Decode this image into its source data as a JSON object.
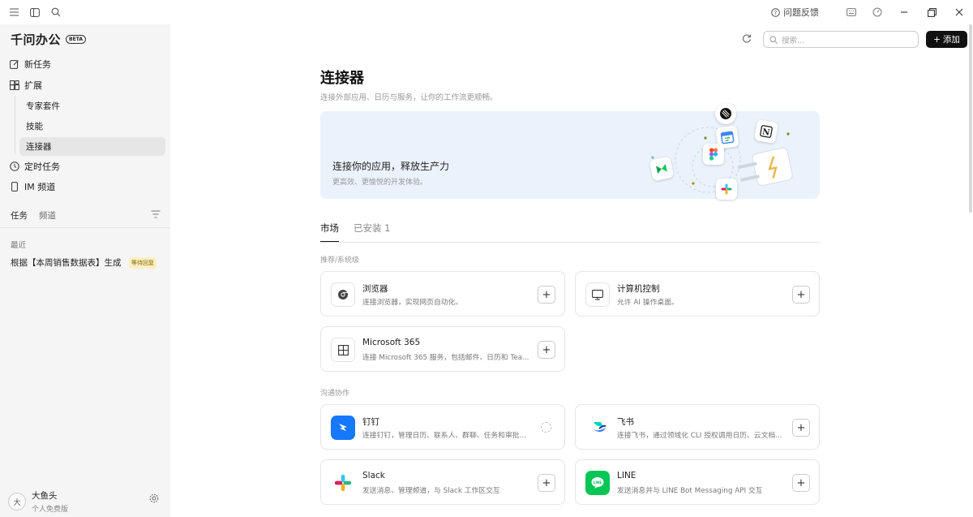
{
  "titlebar": {
    "feedback_label": "问题反馈",
    "icons": [
      "menu-icon",
      "sidebar-toggle-icon",
      "search-icon",
      "feedback-icon",
      "keyboard-icon",
      "speed-icon",
      "minimize-icon",
      "restore-icon",
      "close-icon"
    ]
  },
  "sidebar": {
    "brand": "千问办公",
    "beta": "BETA",
    "new_task": "新任务",
    "extend": "扩展",
    "sub_items": [
      "专家套件",
      "技能",
      "连接器"
    ],
    "scheduled": "定时任务",
    "im_channel": "IM 频道",
    "tab_tasks": "任务",
    "tab_channels": "频道",
    "recent_label": "最近",
    "recent_task": "根据【本周销售数据表】生成",
    "recent_badge": "等待回复",
    "user_name": "大鱼头",
    "user_plan": "个人免费版",
    "avatar_text": "大"
  },
  "main": {
    "search_placeholder": "搜索...",
    "add_label": "添加",
    "title": "连接器",
    "subtitle": "连接外部应用、日历与服务，让你的工作流更顺畅。",
    "banner_title": "连接你的应用，释放生产力",
    "banner_sub": "更高效、更愉悦的开发体验。",
    "tab_market": "市场",
    "tab_installed": "已安装",
    "installed_count": "1",
    "section_recommended": "推荐/系统级",
    "section_collab": "沟通协作",
    "cards": [
      {
        "name": "浏览器",
        "desc": "连接浏览器，实现网页自动化。"
      },
      {
        "name": "计算机控制",
        "desc": "允许 AI 操作桌面。"
      },
      {
        "name": "Microsoft 365",
        "desc": "连接 Microsoft 365 服务，包括邮件、日历和 Tea..."
      },
      {
        "name": "钉钉",
        "desc": "连接钉钉，管理日历、联系人、群聊、任务和审批..."
      },
      {
        "name": "飞书",
        "desc": "连接飞书，通过领域化 CLI 授权调用日历、云文档..."
      },
      {
        "name": "Slack",
        "desc": "发送消息、管理频道，与 Slack 工作区交互"
      },
      {
        "name": "LINE",
        "desc": "发送消息并与 LINE Bot Messaging API 交互"
      }
    ]
  },
  "colors": {
    "sidebar_bg": "#f5f5f5",
    "banner_bg": "#eaf2fb",
    "dingtalk": "#1677ff",
    "line_green": "#06c755",
    "accent_dark": "#111111"
  }
}
